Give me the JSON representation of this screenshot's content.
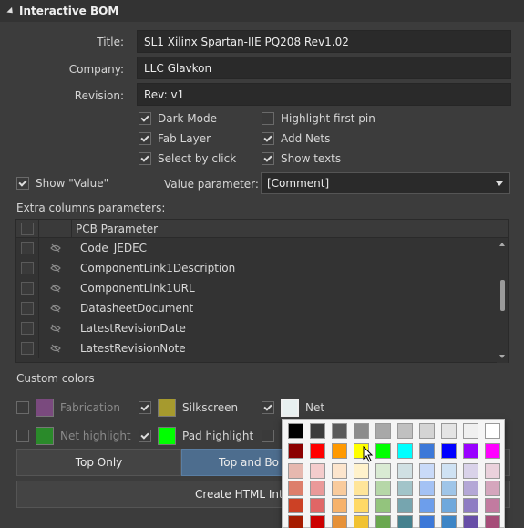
{
  "panel": {
    "title": "Interactive BOM"
  },
  "fields": {
    "title": {
      "label": "Title:",
      "value": "SL1 Xilinx Spartan-IIE PQ208 Rev1.02"
    },
    "company": {
      "label": "Company:",
      "value": "LLC Glavkon"
    },
    "revision": {
      "label": "Revision:",
      "value": "Rev: v1"
    }
  },
  "options": {
    "dark_mode": {
      "label": "Dark Mode",
      "checked": true
    },
    "fab_layer": {
      "label": "Fab Layer",
      "checked": true
    },
    "select_by_click": {
      "label": "Select by click",
      "checked": true
    },
    "highlight_first_pin": {
      "label": "Highlight first pin",
      "checked": false
    },
    "add_nets": {
      "label": "Add Nets",
      "checked": true
    },
    "show_texts": {
      "label": "Show texts",
      "checked": true
    }
  },
  "show_value": {
    "label": "Show \"Value\"",
    "checked": true
  },
  "value_parameter": {
    "label": "Value parameter:",
    "selected": "[Comment]"
  },
  "extra_columns": {
    "label": "Extra columns parameters:",
    "header": "PCB Parameter",
    "rows": [
      "Code_JEDEC",
      "ComponentLink1Description",
      "ComponentLink1URL",
      "DatasheetDocument",
      "LatestRevisionDate",
      "LatestRevisionNote"
    ]
  },
  "custom_colors": {
    "label": "Custom colors",
    "fabrication": {
      "label": "Fabrication",
      "color": "#7a4a7e",
      "checked": false
    },
    "silkscreen": {
      "label": "Silkscreen",
      "color": "#a69a2e",
      "checked": true
    },
    "net": {
      "label": "Net",
      "color": "#e8f0f0",
      "checked": true
    },
    "net_highlight": {
      "label": "Net highlight",
      "color": "#2a8a2a",
      "checked": false
    },
    "pad_highlight": {
      "label": "Pad highlight",
      "color": "#00ff00",
      "checked": true
    }
  },
  "layer_buttons": {
    "top_only": "Top Only",
    "top_and_bottom": "Top and Bo"
  },
  "create_button": "Create HTML Inter",
  "palette": {
    "row1": [
      "#000000",
      "#3c3c3c",
      "#5a5a5a",
      "#8c8c8c",
      "#a8a8a8",
      "#c0c0c0",
      "#d4d4d4",
      "#e4e4e4",
      "#f0f0f0",
      "#ffffff"
    ],
    "row2": [
      "#8b0000",
      "#ff0000",
      "#ff9900",
      "#ffff00",
      "#00ff00",
      "#00ffff",
      "#3c78d8",
      "#0000ff",
      "#9900ff",
      "#ff00ff"
    ],
    "tints": [
      [
        "#e6b8af",
        "#f4cccc",
        "#fce5cd",
        "#fff2cc",
        "#d9ead3",
        "#d0e0e3",
        "#c9daf8",
        "#cfe2f3",
        "#d9d2e9",
        "#ead1dc"
      ],
      [
        "#dd7e6b",
        "#ea9999",
        "#f9cb9c",
        "#ffe599",
        "#b6d7a8",
        "#a2c4c9",
        "#a4c2f4",
        "#9fc5e8",
        "#b4a7d6",
        "#d5a6bd"
      ],
      [
        "#cc4125",
        "#e06666",
        "#f6b26b",
        "#ffd966",
        "#93c47d",
        "#76a5af",
        "#6d9eeb",
        "#6fa8dc",
        "#8e7cc3",
        "#c27ba0"
      ],
      [
        "#a61c00",
        "#cc0000",
        "#e69138",
        "#f1c232",
        "#6aa84f",
        "#45818e",
        "#3c78d8",
        "#3d85c6",
        "#674ea7",
        "#a64d79"
      ]
    ]
  }
}
